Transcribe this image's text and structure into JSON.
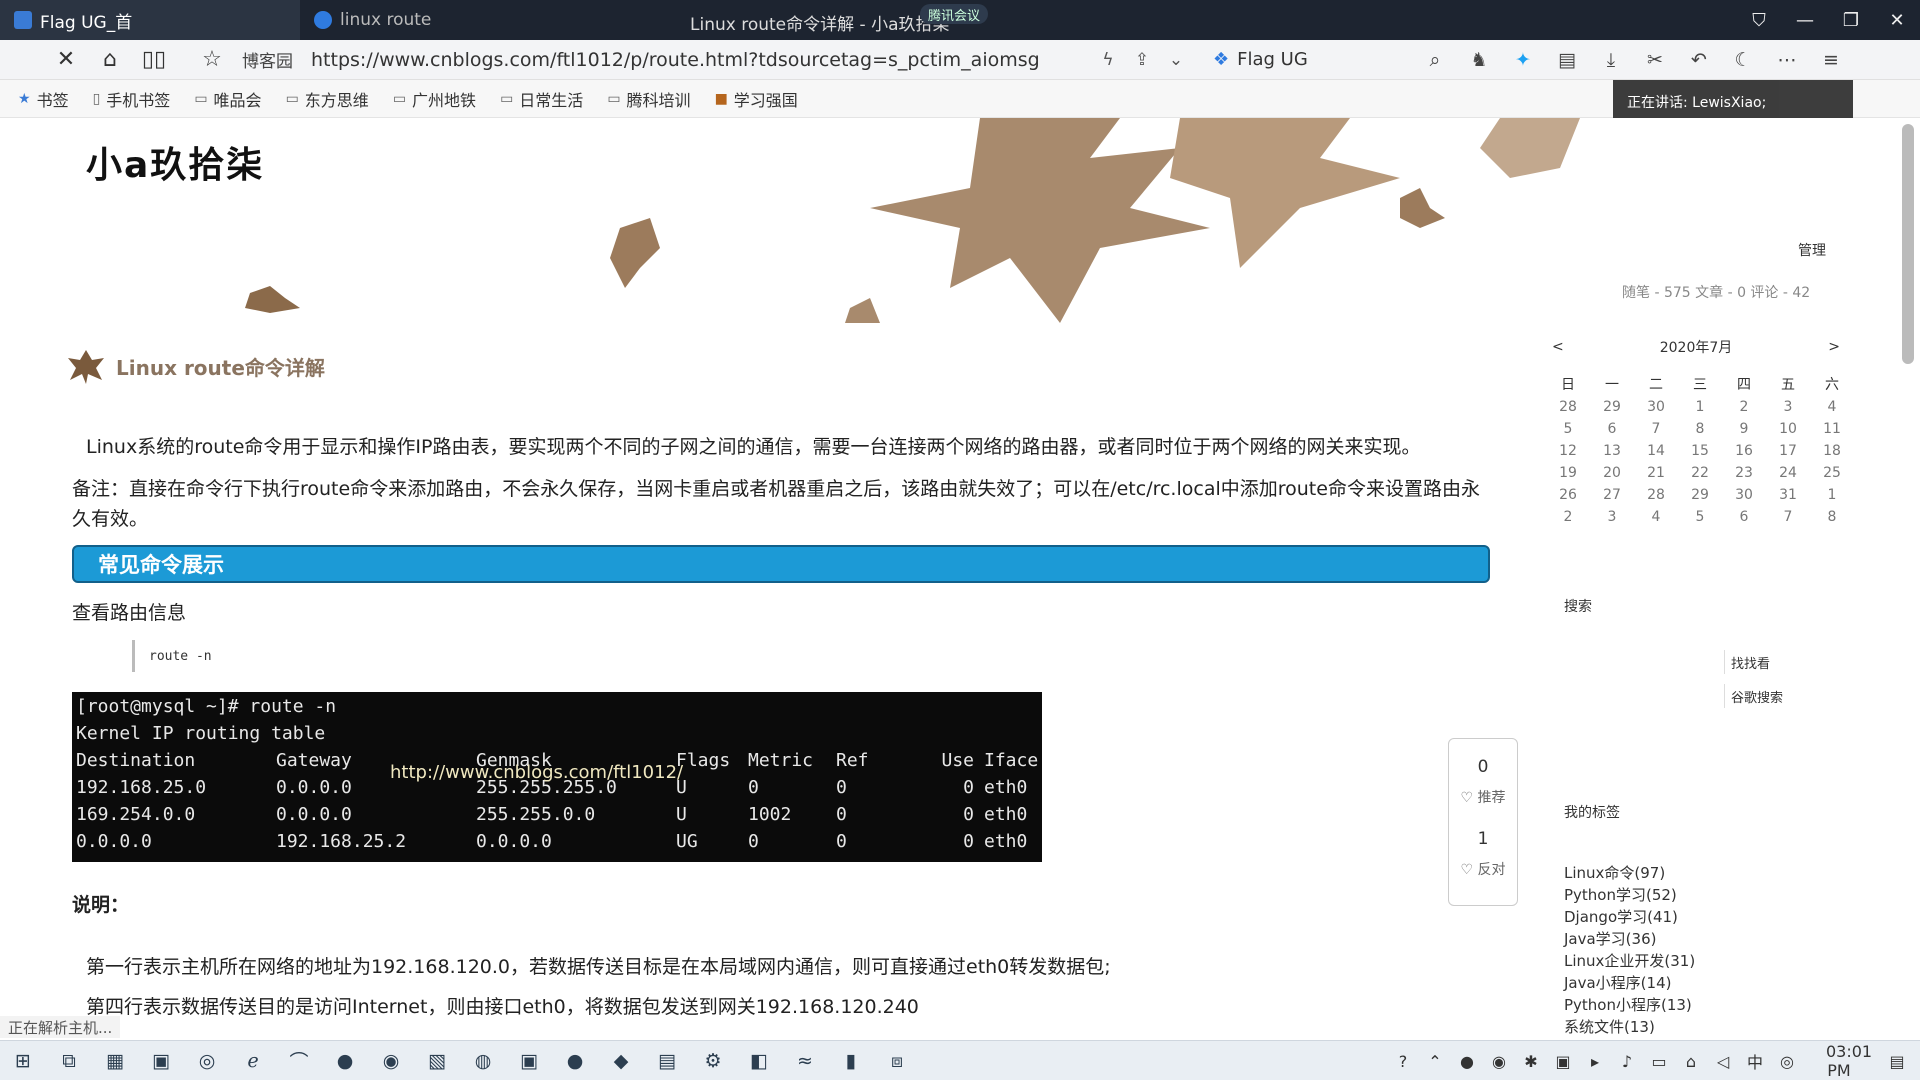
{
  "browser": {
    "tabs": [
      {
        "label": "Flag UG_首"
      },
      {
        "label": "linux route"
      }
    ],
    "window_title": "Linux route命令详解 - 小a玖拾柒",
    "meeting_label": "腾讯会议",
    "address": {
      "site_label": "博客园",
      "url": "https://www.cnblogs.com/ftl1012/p/route.html?tdsourcetag=s_pctim_aiomsg"
    },
    "search_engine": "Flag UG",
    "speaking_banner": "正在讲话: LewisXiao;",
    "bookmarks": [
      {
        "label": "书签"
      },
      {
        "label": "手机书签"
      },
      {
        "label": "唯品会"
      },
      {
        "label": "东方思维"
      },
      {
        "label": "广州地铁"
      },
      {
        "label": "日常生活"
      },
      {
        "label": "腾科培训"
      },
      {
        "label": "学习强国"
      }
    ]
  },
  "blog": {
    "title": "小a玖拾柒",
    "admin": "管理",
    "stats": "随笔 - 575  文章 - 0  评论 - 42"
  },
  "post": {
    "title": "Linux route命令详解",
    "para1": "Linux系统的route命令用于显示和操作IP路由表，要实现两个不同的子网之间的通信，需要一台连接两个网络的路由器，或者同时位于两个网络的网关来实现。",
    "para2": "备注：直接在命令行下执行route命令来添加路由，不会永久保存，当网卡重启或者机器重启之后，该路由就失效了；可以在/etc/rc.local中添加route命令来设置路由永久有效。",
    "section": "常见命令展示",
    "view_route": "查看路由信息",
    "code": "route -n",
    "terminal": {
      "prompt": "[root@mysql ~]# route -n",
      "line2": "Kernel IP routing table",
      "headers": [
        "Destination",
        "Gateway",
        "Genmask",
        "Flags",
        "Metric",
        "Ref",
        "Use",
        "Iface"
      ],
      "rows": [
        [
          "192.168.25.0",
          "0.0.0.0",
          "255.255.255.0",
          "U",
          "0",
          "0",
          "0",
          "eth0"
        ],
        [
          "169.254.0.0",
          "0.0.0.0",
          "255.255.0.0",
          "U",
          "1002",
          "0",
          "0",
          "eth0"
        ],
        [
          "0.0.0.0",
          "192.168.25.2",
          "0.0.0.0",
          "UG",
          "0",
          "0",
          "0",
          "eth0"
        ]
      ],
      "watermark": "http://www.cnblogs.com/ftl1012/"
    },
    "explain_heading": "说明：",
    "explain_line1": "第一行表示主机所在网络的地址为192.168.120.0，若数据传送目标是在本局域网内通信，则可直接通过eth0转发数据包;",
    "explain_line2": "第四行表示数据传送目的是访问Internet，则由接口eth0，将数据包发送到网关192.168.120.240"
  },
  "vote": {
    "up_count": "0",
    "up_label": "推荐",
    "down_count": "1",
    "down_label": "反对"
  },
  "calendar": {
    "month": "2020年7月",
    "prev": "<",
    "next": ">",
    "weekdays": [
      "日",
      "一",
      "二",
      "三",
      "四",
      "五",
      "六"
    ],
    "days": [
      "28",
      "29",
      "30",
      "1",
      "2",
      "3",
      "4",
      "5",
      "6",
      "7",
      "8",
      "9",
      "10",
      "11",
      "12",
      "13",
      "14",
      "15",
      "16",
      "17",
      "18",
      "19",
      "20",
      "21",
      "22",
      "23",
      "24",
      "25",
      "26",
      "27",
      "28",
      "29",
      "30",
      "31",
      "1",
      "2",
      "3",
      "4",
      "5",
      "6",
      "7",
      "8"
    ]
  },
  "sidebar": {
    "search_heading": "搜索",
    "search_btn1": "找找看",
    "search_btn2": "谷歌搜索",
    "tags_heading": "我的标签",
    "tags": [
      "Linux命令(97)",
      "Python学习(52)",
      "Django学习(41)",
      "Java学习(36)",
      "Linux企业开发(31)",
      "Java小程序(14)",
      "Python小程序(13)",
      "系统文件(13)"
    ]
  },
  "status_text": "正在解析主机...",
  "taskbar": {
    "clock": "03:01 PM"
  }
}
